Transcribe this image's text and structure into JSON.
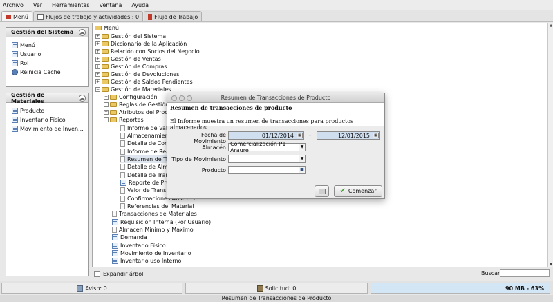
{
  "menubar": {
    "items": [
      {
        "label": "Archivo",
        "ul": "A",
        "rest": "rchivo"
      },
      {
        "label": "Ver",
        "ul": "V",
        "rest": "er"
      },
      {
        "label": "Herramientas",
        "ul": "H",
        "rest": "erramientas"
      },
      {
        "label": "Ventana",
        "ul": "",
        "rest": "Ventana"
      },
      {
        "label": "Ayuda",
        "ul": "",
        "rest": "Ayuda"
      }
    ]
  },
  "tabs": {
    "menu": "Menú",
    "workflows": "Flujos de trabajo y actividades.: 0",
    "workflow": "Flujo de Trabajo"
  },
  "sidebar": {
    "system_title": "Gestión del Sistema",
    "system_items": [
      "Menú",
      "Usuario",
      "Rol",
      "Reinicia Cache"
    ],
    "materials_title": "Gestión de Materiales",
    "materials_items": [
      "Producto",
      "Inventario Físico",
      "Movimiento de Inven..."
    ]
  },
  "tree": {
    "root": "Menú",
    "top": [
      "Gestión del Sistema",
      "Diccionario de la Aplicación",
      "Relación con Socios del Negocio",
      "Gestión de Ventas",
      "Gestión de Compras",
      "Gestión de Devoluciones",
      "Gestión de Saldos Pendientes",
      "Gestión de Materiales"
    ],
    "materials_sub": [
      "Configuración",
      "Reglas de Gestión",
      "Atributos del Produ...",
      "Reportes"
    ],
    "reports": [
      "Informe de Valo...",
      "Almacenamiento...",
      "Detalle de Conf...",
      "Informe de Rea...",
      "Resumen de Tr...",
      "Detalle de Alma...",
      "Detalle de Tran...",
      "Reporte de Prod...",
      "Valor de Transa...",
      "Confirmaciones Abiertas",
      "Referencias del Material"
    ],
    "materials_tail": [
      "Transacciones de Materiales",
      "Requisición Interna (Por Usuario)",
      "Almacen Mínimo y Maximo",
      "Demanda",
      "Inventario Físico",
      "Movimiento de Inventario",
      "Inventario uso Interno"
    ]
  },
  "bottom": {
    "expand_label": "Expandir árbol",
    "search_label": "Buscar"
  },
  "status": {
    "aviso": "Aviso: 0",
    "solicitud": "Solicitud: 0",
    "memory": "90 MB - 63%",
    "footer": "Resumen de Transacciones de Producto"
  },
  "dialog": {
    "window_title": "Resumen de Transacciones de Producto",
    "heading": "Resumen de transacciones de producto",
    "description": "El Informe muestra un resumen de transacciones para productos almacenados",
    "fecha_label": "Fecha de Movimiento",
    "fecha_from": "01/12/2014",
    "fecha_dash": "-",
    "fecha_to": "12/01/2015",
    "almacen_label": "Almacén",
    "almacen_value": "Comercialización P1 Araure",
    "tipo_label": "Tipo de Movimiento",
    "tipo_value": "",
    "producto_label": "Producto",
    "producto_value": "",
    "ok_label_prefix": "C",
    "ok_label_rest": "omenzar"
  },
  "colors": {
    "date_bg": "#cfdff0",
    "memory_bg": "#d3e6f5",
    "folder": "#e9c865"
  }
}
